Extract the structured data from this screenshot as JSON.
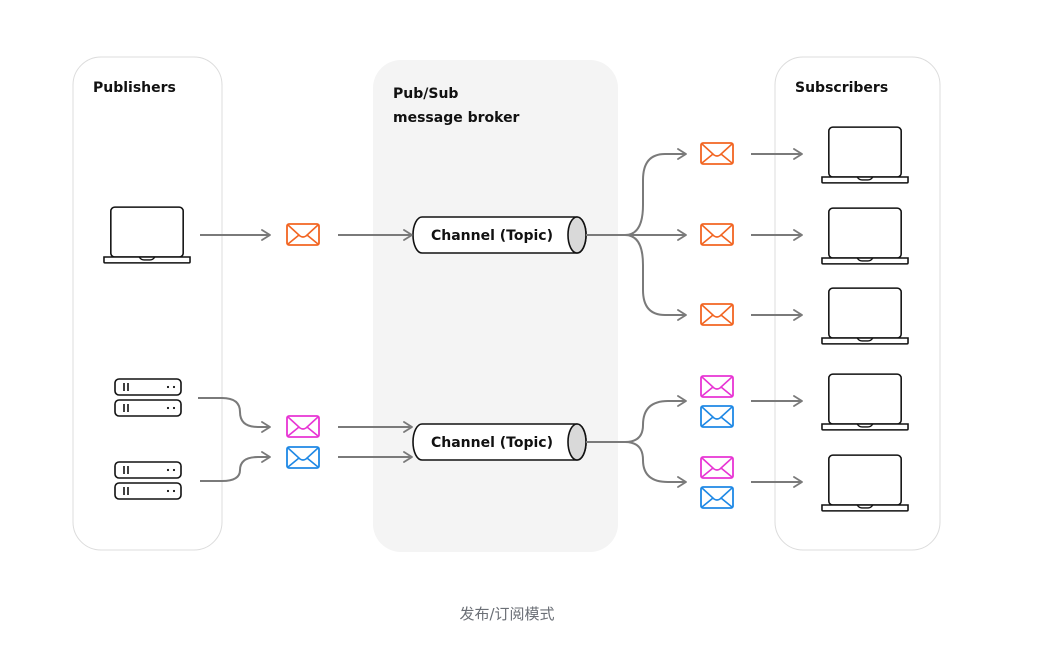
{
  "panels": {
    "publishers": {
      "title": "Publishers"
    },
    "broker": {
      "title_line1": "Pub/Sub",
      "title_line2": "message broker"
    },
    "subscribers": {
      "title": "Subscribers"
    }
  },
  "channels": [
    {
      "label": "Channel (Topic)"
    },
    {
      "label": "Channel (Topic)"
    }
  ],
  "publishers": [
    {
      "type": "laptop",
      "icon": "laptop-icon"
    },
    {
      "type": "server",
      "icon": "server-icon"
    },
    {
      "type": "server",
      "icon": "server-icon"
    }
  ],
  "subscribers": [
    {
      "type": "laptop",
      "icon": "laptop-icon",
      "messages": [
        "orange"
      ]
    },
    {
      "type": "laptop",
      "icon": "laptop-icon",
      "messages": [
        "orange"
      ]
    },
    {
      "type": "laptop",
      "icon": "laptop-icon",
      "messages": [
        "orange"
      ]
    },
    {
      "type": "laptop",
      "icon": "laptop-icon",
      "messages": [
        "magenta",
        "blue"
      ]
    },
    {
      "type": "laptop",
      "icon": "laptop-icon",
      "messages": [
        "magenta",
        "blue"
      ]
    }
  ],
  "message_colors": {
    "orange": "#f26522",
    "magenta": "#e834d4",
    "blue": "#1e88e5"
  },
  "colors": {
    "arrow": "#7a7a7a",
    "broker_bg": "#f4f4f4",
    "panel_border": "#dcdcdc",
    "outline": "#111111",
    "cylinder_cap": "#d9d9d9"
  },
  "caption": "发布/订阅模式"
}
